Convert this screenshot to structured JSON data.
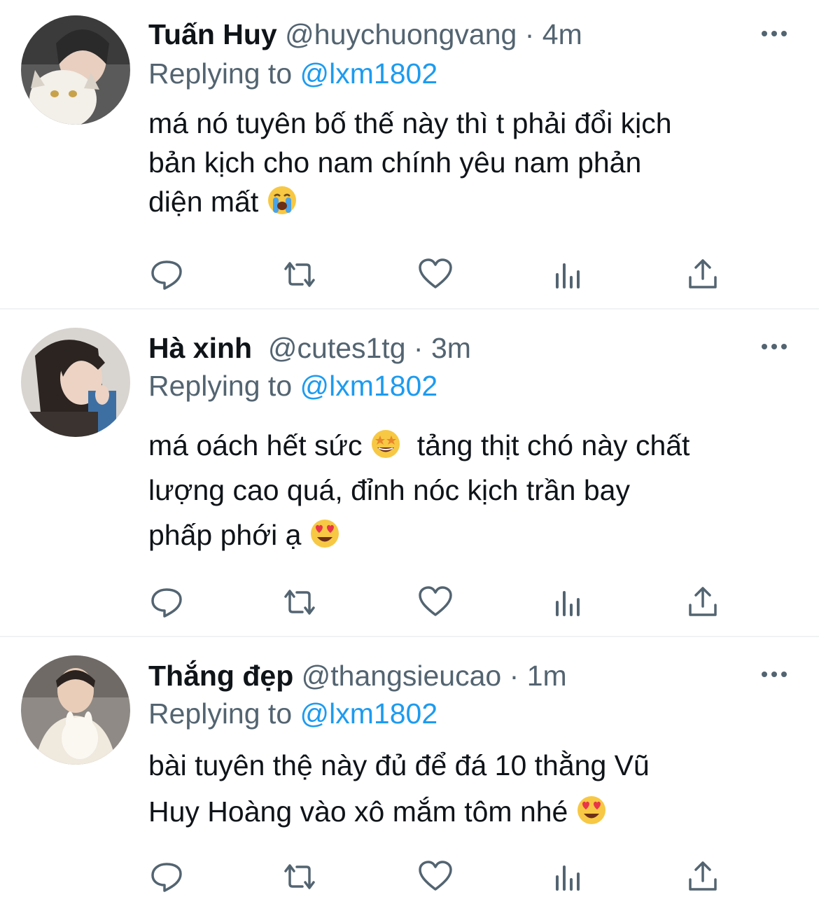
{
  "replying_label": "Replying to",
  "colors": {
    "text": "#0f1419",
    "secondary": "#536471",
    "link": "#1d9bf0",
    "divider": "#eff3f4"
  },
  "tweets": [
    {
      "name": "Tuấn Huy",
      "handle": "@huychuongvang",
      "separator": "·",
      "time": "4m",
      "reply_to": "@lxm1802",
      "text_lines": [
        "má nó tuyên bố thế này thì t phải đổi kịch",
        "bản kịch cho nam chính yêu nam phản",
        "diện mất"
      ],
      "emojis": [
        "loudly-crying-face"
      ]
    },
    {
      "name": "Hà xinh",
      "handle": "@cutes1tg",
      "separator": "·",
      "time": "3m",
      "reply_to": "@lxm1802",
      "text_lines": [
        "má oách hết sức",
        "tảng thịt chó này chất",
        "lượng cao quá, đỉnh nóc kịch trần bay",
        "phấp phới ạ"
      ],
      "emojis": [
        "star-struck-face",
        "heart-eyes-face"
      ]
    },
    {
      "name": "Thắng đẹp",
      "handle": "@thangsieucao",
      "separator": "·",
      "time": "1m",
      "reply_to": "@lxm1802",
      "text_lines": [
        "bài tuyên thệ này đủ để đá 10 thằng Vũ",
        "Huy Hoàng vào xô mắm tôm nhé"
      ],
      "emojis": [
        "heart-eyes-face"
      ]
    }
  ],
  "action_icons": [
    "reply-icon",
    "retweet-icon",
    "like-icon",
    "analytics-icon",
    "share-icon"
  ]
}
